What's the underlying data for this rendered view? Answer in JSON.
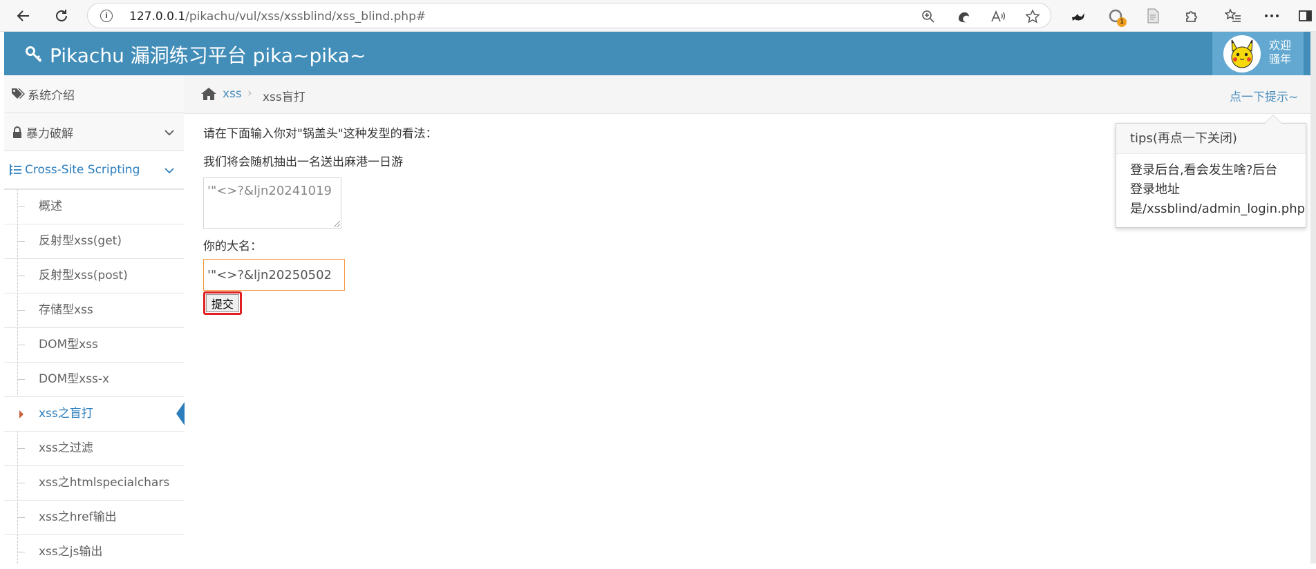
{
  "browser": {
    "url_host": "127.0.0.1",
    "url_path": "/pikachu/vul/xss/xssblind/xss_blind.php#",
    "extension_badge": "1"
  },
  "header": {
    "brand": "Pikachu 漏洞练习平台 pika~pika~",
    "welcome_line1": "欢迎",
    "welcome_line2": "骚年",
    "color": "#438eb9"
  },
  "sidebar": {
    "top_items": [
      {
        "label": "系统介绍",
        "icon": "tags-icon"
      },
      {
        "label": "暴力破解",
        "icon": "lock-icon"
      },
      {
        "label": "Cross-Site Scripting",
        "icon": "list-icon"
      }
    ],
    "sub_items": [
      "概述",
      "反射型xss(get)",
      "反射型xss(post)",
      "存储型xss",
      "DOM型xss",
      "DOM型xss-x",
      "xss之盲打",
      "xss之过滤",
      "xss之htmlspecialchars",
      "xss之href输出",
      "xss之js输出"
    ],
    "active_sub": "xss之盲打",
    "accent": "#2b7dbc"
  },
  "breadcrumb": {
    "link": "xss",
    "separator": "›",
    "current": "xss盲打",
    "hint": "点一下提示~"
  },
  "main": {
    "prompt_line1": "请在下面输入你对\"锅盖头\"这种发型的看法：",
    "prompt_line2": "我们将会随机抽出一名送出麻港一日游",
    "opinion_value": "'\"<>?&ljn20241019",
    "name_label": "你的大名：",
    "name_value": "'\"<>?&ljn20250502",
    "submit_label": "提交"
  },
  "popover": {
    "title": "tips(再点一下关闭)",
    "line1": "登录后台,看会发生啥?后台",
    "line2": "登录地址",
    "line3": "是/xssblind/admin_login.php"
  }
}
